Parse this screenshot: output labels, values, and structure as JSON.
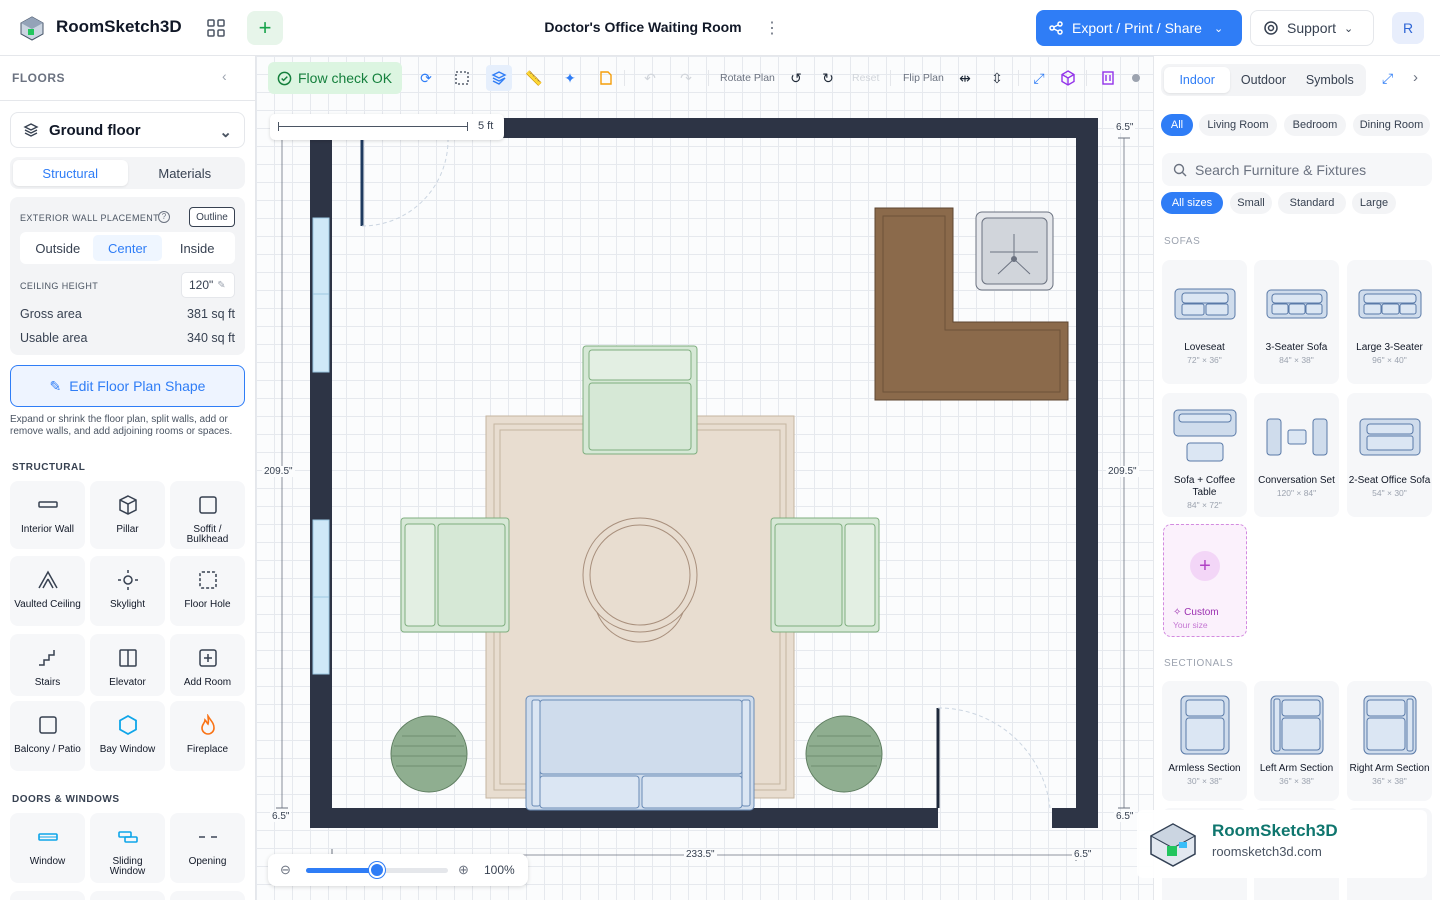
{
  "app": {
    "title": "RoomSketch3D"
  },
  "header": {
    "doc_title": "Doctor's Office Waiting Room",
    "export_label": "Export / Print / Share",
    "support_label": "Support",
    "avatar_initial": "R"
  },
  "left": {
    "floors_heading": "FLOORS",
    "floor_name": "Ground floor",
    "tabs": [
      "Structural",
      "Materials"
    ],
    "wall_placement_label": "EXTERIOR WALL PLACEMENT",
    "outline_label": "Outline",
    "placement_options": [
      "Outside",
      "Center",
      "Inside"
    ],
    "ceiling_label": "CEILING HEIGHT",
    "ceiling_value": "120\"",
    "gross_label": "Gross area",
    "gross_value": "381 sq ft",
    "usable_label": "Usable area",
    "usable_value": "340 sq ft",
    "edit_label": "Edit Floor Plan Shape",
    "edit_desc": "Expand or shrink the floor plan, split walls, add or remove walls, and add adjoining rooms or spaces.",
    "structural_heading": "STRUCTURAL",
    "structural_items": [
      {
        "label": "Interior Wall",
        "icon": "interior-wall-icon"
      },
      {
        "label": "Pillar",
        "icon": "pillar-icon"
      },
      {
        "label": "Soffit / Bulkhead",
        "icon": "soffit-icon"
      },
      {
        "label": "Vaulted Ceiling",
        "icon": "vaulted-ceiling-icon"
      },
      {
        "label": "Skylight",
        "icon": "skylight-icon"
      },
      {
        "label": "Floor Hole",
        "icon": "floor-hole-icon"
      },
      {
        "label": "Stairs",
        "icon": "stairs-icon"
      },
      {
        "label": "Elevator",
        "icon": "elevator-icon"
      },
      {
        "label": "Add Room",
        "icon": "add-room-icon"
      },
      {
        "label": "Balcony / Patio",
        "icon": "balcony-icon"
      },
      {
        "label": "Bay Window",
        "icon": "bay-window-icon"
      },
      {
        "label": "Fireplace",
        "icon": "fireplace-icon"
      }
    ],
    "doors_heading": "DOORS & WINDOWS",
    "door_items": [
      {
        "label": "Window",
        "icon": "window-icon"
      },
      {
        "label": "Sliding Window",
        "icon": "sliding-window-icon"
      },
      {
        "label": "Opening",
        "icon": "opening-icon"
      }
    ]
  },
  "toolbar": {
    "flow_label": "Flow check OK",
    "rotate_label": "Rotate Plan",
    "reset_label": "Reset",
    "flip_label": "Flip Plan"
  },
  "canvas": {
    "scale_label": "5 ft",
    "dim_left": "209.5\"",
    "dim_right": "209.5\"",
    "dim_bottom": "233.5\"",
    "dim_top_right": "6.5\"",
    "dim_bottom_left": "6.5\"",
    "dim_bottom_right": "6.5\"",
    "dim_bottom_right_corner": "6.5\"",
    "zoom_value": "100%",
    "zoom_level": 0.5
  },
  "right": {
    "tabs": [
      "Indoor",
      "Outdoor",
      "Symbols"
    ],
    "room_chips": [
      "All",
      "Living Room",
      "Bedroom",
      "Dining Room"
    ],
    "search_placeholder": "Search Furniture & Fixtures",
    "size_chips": [
      "All sizes",
      "Small",
      "Standard",
      "Large"
    ],
    "sofas_heading": "SOFAS",
    "sofas": [
      {
        "name": "Loveseat",
        "size": "72\" × 36\""
      },
      {
        "name": "3-Seater Sofa",
        "size": "84\" × 38\""
      },
      {
        "name": "Large 3-Seater",
        "size": "96\" × 40\""
      },
      {
        "name": "Sofa + Coffee Table",
        "size": "84\" × 72\""
      },
      {
        "name": "Conversation Set",
        "size": "120\" × 84\""
      },
      {
        "name": "2-Seat Office Sofa",
        "size": "54\" × 30\""
      }
    ],
    "custom_label": "Custom",
    "custom_sub": "Your size",
    "sectionals_heading": "SECTIONALS",
    "sectionals": [
      {
        "name": "Armless Section",
        "size": "30\" × 38\""
      },
      {
        "name": "Left Arm Section",
        "size": "36\" × 38\""
      },
      {
        "name": "Right Arm Section",
        "size": "36\" × 38\""
      }
    ]
  },
  "watermark": {
    "brand": "RoomSketch3D",
    "url": "roomsketch3d.com"
  },
  "colors": {
    "accent": "#2f7df6",
    "wall": "#2d3445",
    "green_ok": "#15803d",
    "rug": "#e8ddd0",
    "chair": "#d6e8d6",
    "brown": "#8b6a4b"
  }
}
